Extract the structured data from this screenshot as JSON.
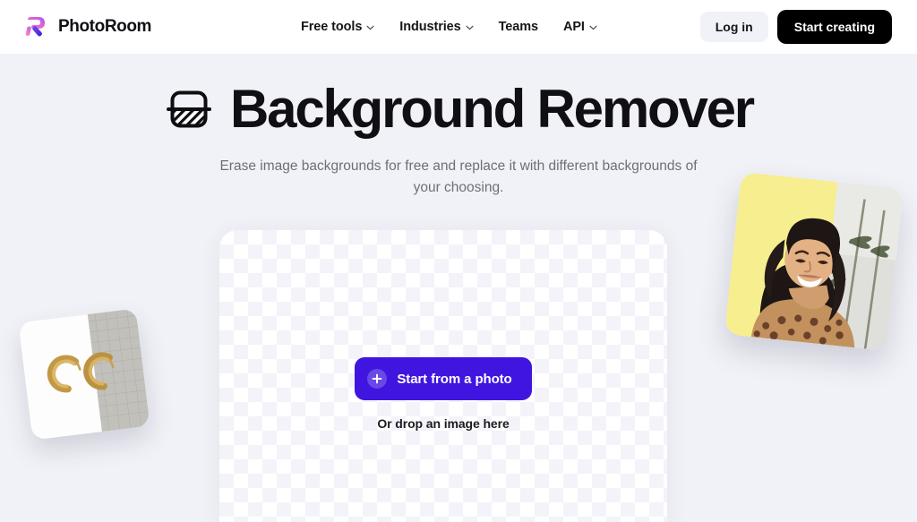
{
  "header": {
    "brand": {
      "name": "PhotoRoom",
      "logo_icon": "photoroom-r-logo"
    },
    "nav": [
      {
        "label": "Free tools",
        "has_chevron": true
      },
      {
        "label": "Industries",
        "has_chevron": true
      },
      {
        "label": "Teams",
        "has_chevron": false
      },
      {
        "label": "API",
        "has_chevron": true
      }
    ],
    "login_label": "Log in",
    "cta_label": "Start creating"
  },
  "hero": {
    "title": "Background Remover",
    "title_icon": "background-remover-icon",
    "subtitle": "Erase image backgrounds for free and replace it with different backgrounds of your choosing."
  },
  "dropzone": {
    "button_label": "Start from a photo",
    "button_icon": "plus-icon",
    "hint": "Or drop an image here"
  },
  "samples": {
    "left": {
      "alt": "gold hoop earrings on split white and gray linen background"
    },
    "right": {
      "alt": "smiling woman with leopard print top on split yellow and palm tree background"
    }
  },
  "colors": {
    "page_background": "#f1f2f7",
    "header_background": "#ffffff",
    "accent_purple": "#4015e0",
    "cta_black": "#000000",
    "title_text": "#100f14",
    "subtitle_text": "#6e6e7a",
    "checker_light": "#ffffff",
    "checker_dark": "#f4f3f9",
    "sample_yellow": "#f6ee8f"
  }
}
